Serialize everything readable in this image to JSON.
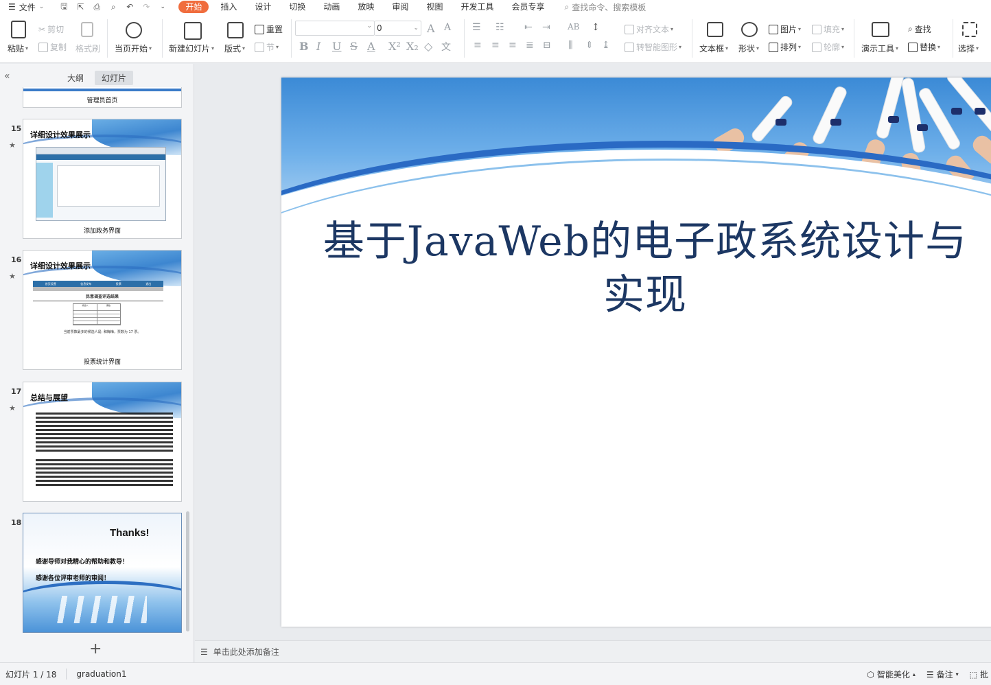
{
  "menubar": {
    "file_label": "文件",
    "tabs": [
      "开始",
      "插入",
      "设计",
      "切换",
      "动画",
      "放映",
      "审阅",
      "视图",
      "开发工具",
      "会员专享"
    ],
    "active_tab": "开始",
    "search_placeholder": "查找命令、搜索模板"
  },
  "ribbon": {
    "paste": "粘贴",
    "cut": "剪切",
    "copy": "复制",
    "format_painter": "格式刷",
    "start_from_current": "当页开始",
    "new_slide": "新建幻灯片",
    "layout": "版式",
    "reset": "重置",
    "section": "节",
    "font_size": "0",
    "align_text": "对齐文本",
    "smart_art": "转智能图形",
    "text_box": "文本框",
    "shape": "形状",
    "picture": "图片",
    "arrange": "排列",
    "fill": "填充",
    "outline": "轮廓",
    "presentation_tools": "演示工具",
    "find": "查找",
    "replace": "替换",
    "select": "选择"
  },
  "panel": {
    "tab_outline": "大纲",
    "tab_slides": "幻灯片",
    "prev_caption": "管理员首页",
    "slides": [
      {
        "number": "15",
        "title": "详细设计效果展示",
        "caption": "添加政务界面"
      },
      {
        "number": "16",
        "title": "详细设计效果展示",
        "caption": "投票统计界面",
        "table_title": "民意调查评选结果",
        "result_text": "当前票数最多的候选人是: 和梅梅，票数为 17 票。",
        "nav": [
          "首页设置",
          "信息发布",
          "投票",
          "退出"
        ],
        "table_headers": [
          "候选人",
          "票数"
        ]
      },
      {
        "number": "17",
        "title": "总结与展望"
      },
      {
        "number": "18",
        "title": "Thanks!",
        "line1": "感谢导师对我精心的帮助和教导！",
        "line2": "感谢各位评审老师的审阅！"
      }
    ]
  },
  "slide": {
    "title": "基于JavaWeb的电子政系统设计与实现"
  },
  "notes": {
    "placeholder": "单击此处添加备注"
  },
  "status": {
    "slide_counter": "幻灯片 1 / 18",
    "theme": "graduation1",
    "smart_beautify": "智能美化",
    "notes_label": "备注",
    "comments_label": "批"
  },
  "colors": {
    "accent": "#f06d3e",
    "title_color": "#1c3763"
  }
}
